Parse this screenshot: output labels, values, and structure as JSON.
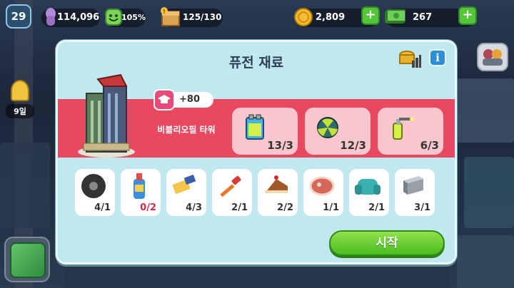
{
  "hud": {
    "level": "29",
    "population": "114,096",
    "happiness": "105%",
    "storage": "125/130",
    "coins": "2,809",
    "cash": "267",
    "plus_label": "+"
  },
  "sidebar": {
    "days": "9일"
  },
  "modal": {
    "title": "퓨전 재료",
    "info_label": "i",
    "building_name": "비블리오필 타워",
    "xp": "+80",
    "start_label": "시작",
    "main_materials": [
      {
        "name": "battery-icon",
        "count": "13/3"
      },
      {
        "name": "radiation-ball-icon",
        "count": "12/3"
      },
      {
        "name": "blowtorch-icon",
        "count": "6/3"
      }
    ],
    "materials": [
      {
        "name": "tire-icon",
        "count": "4/1",
        "short": false
      },
      {
        "name": "glue-bottle-icon",
        "count": "0/2",
        "short": true
      },
      {
        "name": "brush-icon",
        "count": "4/3",
        "short": false
      },
      {
        "name": "screwdriver-icon",
        "count": "2/1",
        "short": false
      },
      {
        "name": "cake-icon",
        "count": "2/2",
        "short": false
      },
      {
        "name": "steak-icon",
        "count": "1/1",
        "short": false
      },
      {
        "name": "armchair-icon",
        "count": "2/1",
        "short": false
      },
      {
        "name": "steel-beam-icon",
        "count": "3/1",
        "short": false
      }
    ]
  },
  "colors": {
    "modal_bg": "#bfe9ee",
    "red_band": "#e84860",
    "start_button": "#4bbb22",
    "shortage_text": "#d8284a"
  }
}
